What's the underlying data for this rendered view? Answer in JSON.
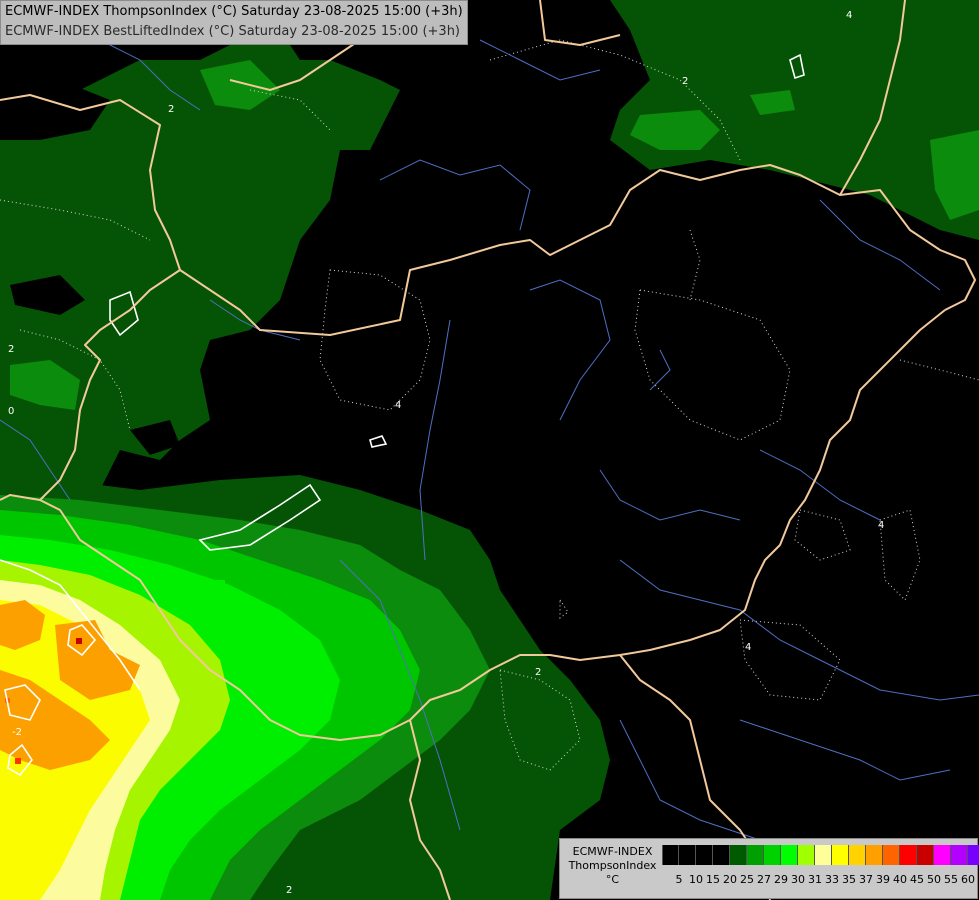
{
  "header": {
    "line1": "ECMWF-INDEX ThompsonIndex (°C) Saturday 23-08-2025 15:00 (+3h)",
    "line2": "ECMWF-INDEX BestLiftedIndex (°C) Saturday 23-08-2025 15:00 (+3h)"
  },
  "contour_labels": [
    "4",
    "4",
    "4",
    "4",
    "2",
    "2",
    "2",
    "2",
    "0",
    "-2",
    "2"
  ],
  "legend": {
    "title_line1": "ECMWF-INDEX",
    "title_line2": "ThompsonIndex",
    "title_line3": "°C",
    "colors": [
      "#000000",
      "#000000",
      "#000000",
      "#000000",
      "#005a00",
      "#00a000",
      "#00d200",
      "#00ff00",
      "#a0ff00",
      "#ffff99",
      "#ffff00",
      "#ffd200",
      "#ffa000",
      "#ff6400",
      "#ff0000",
      "#c80000",
      "#ff00ff",
      "#b400ff",
      "#7800ff",
      "#0000ff"
    ],
    "ticks": [
      "5",
      "10",
      "15",
      "20",
      "25",
      "27",
      "29",
      "30",
      "31",
      "33",
      "35",
      "37",
      "39",
      "40",
      "45",
      "50",
      "55",
      "60"
    ]
  },
  "colors": {
    "dark_green": "#055405",
    "mid_green": "#0c8c0c",
    "green": "#00c600",
    "bright_green": "#00ee00",
    "lime": "#a6f400",
    "light_yellow": "#fcfc9e",
    "yellow": "#fcfc00",
    "gold": "#fcd000",
    "orange": "#fca000",
    "border": "#f2c99b",
    "river": "#4f6fc4"
  }
}
